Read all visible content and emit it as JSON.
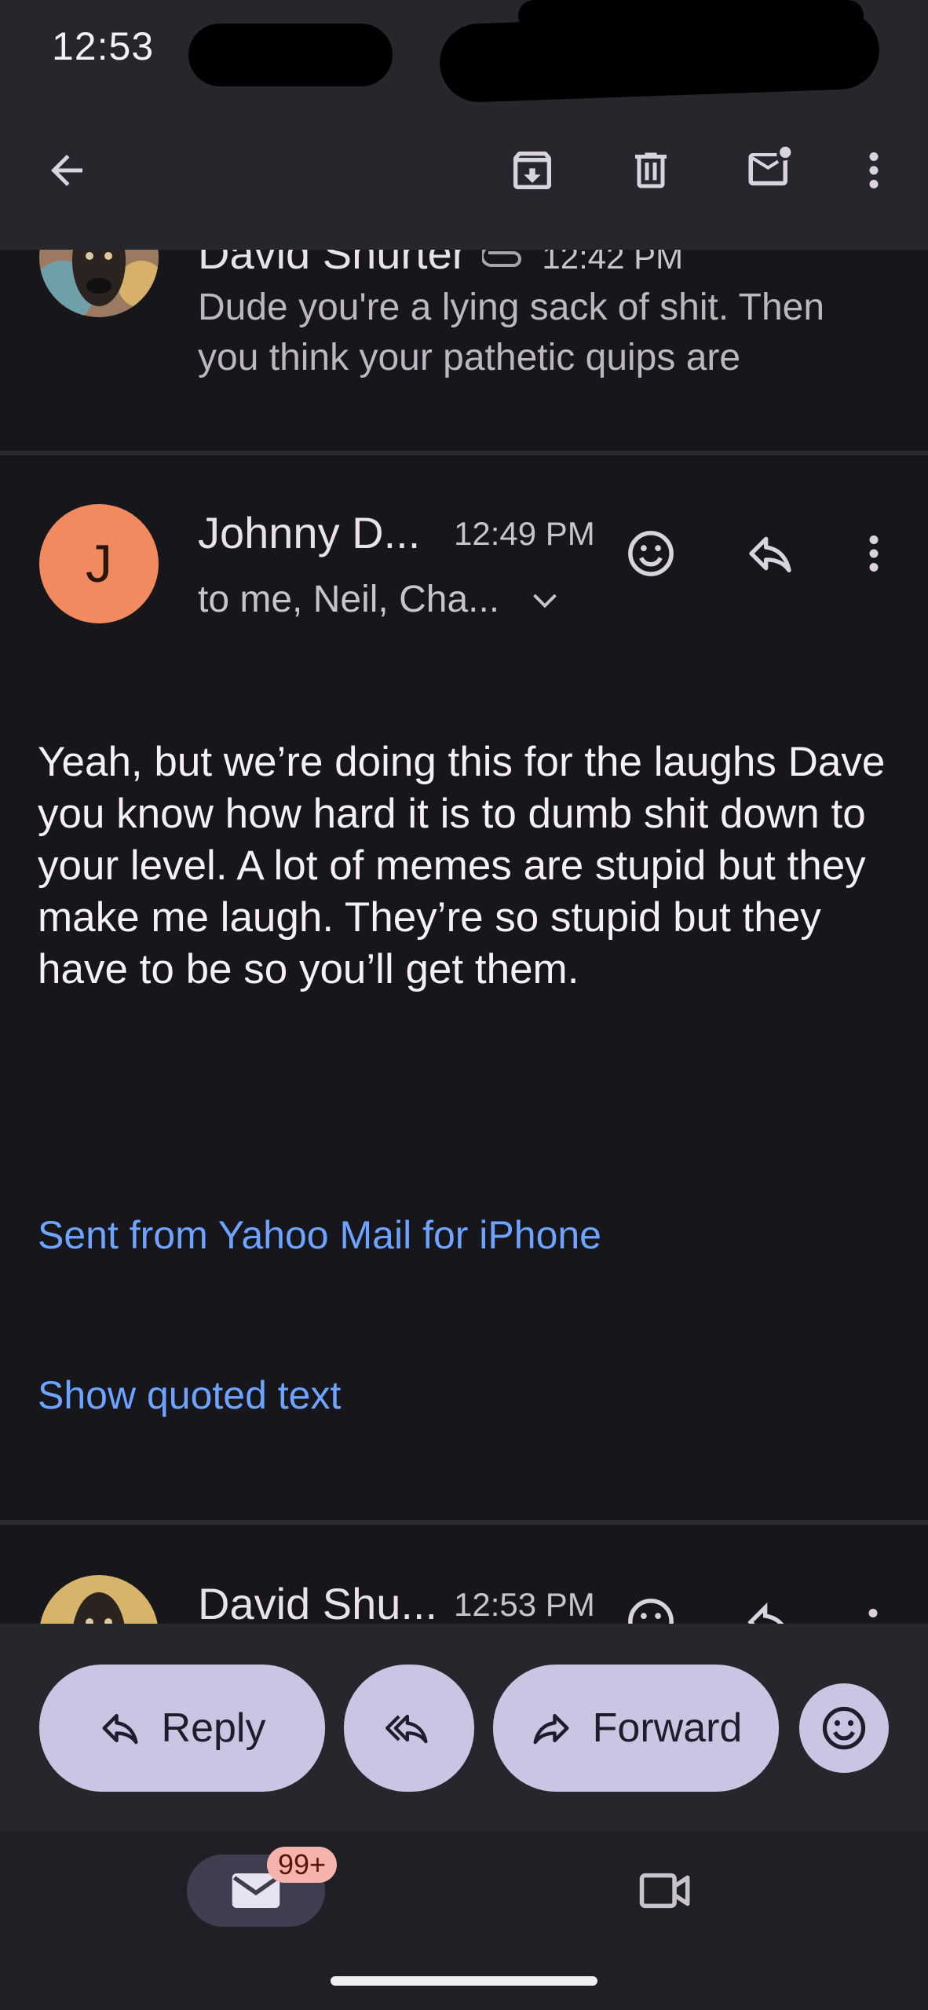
{
  "status": {
    "time": "12:53"
  },
  "toolbar": {
    "back_icon": "arrow-left-icon",
    "archive_icon": "archive-icon",
    "delete_icon": "trash-icon",
    "mark_unread_icon": "mail-unread-icon",
    "more_icon": "more-vert-icon"
  },
  "messages": [
    {
      "sender": "David Shurter",
      "time": "12:42 PM",
      "snippet_line1": "Dude you're a lying sack of shit. Then",
      "snippet_line2": "you think your pathetic quips are"
    },
    {
      "sender": "Johnny D...",
      "avatar_letter": "J",
      "time": "12:49 PM",
      "recipients": "to me, Neil, Cha...",
      "body": "Yeah, but we’re doing this for the laughs Dave you know how hard it is to dumb shit down to your level. A lot of memes are stupid but they make me laugh. They’re so stupid but they have to be so you’ll get them.",
      "signature": "Sent from Yahoo Mail for iPhone",
      "show_quoted": "Show quoted text"
    },
    {
      "sender": "David Shu...",
      "time": "12:53 PM"
    }
  ],
  "actions": {
    "reply": "Reply",
    "forward": "Forward"
  },
  "nav": {
    "mail_badge": "99+"
  },
  "colors": {
    "background": "#16161b",
    "toolbar": "#26262d",
    "avatar_j": "#f28a60",
    "link": "#6ea4ff",
    "pill": "#cbc5e3",
    "badge": "#f6b3ad"
  }
}
